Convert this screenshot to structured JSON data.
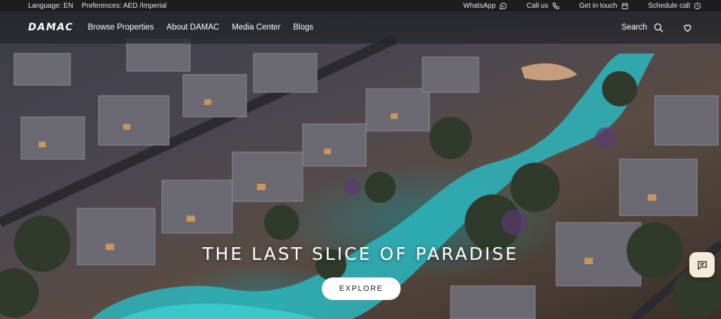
{
  "topbar": {
    "language": "Language: EN",
    "preferences": "Preferences: AED /Imperial",
    "links": [
      {
        "label": "WhatsApp",
        "icon": "whatsapp-icon"
      },
      {
        "label": "Call us",
        "icon": "phone-icon"
      },
      {
        "label": "Get in touch",
        "icon": "calendar-icon"
      },
      {
        "label": "Schedule call",
        "icon": "clock-phone-icon"
      }
    ]
  },
  "nav": {
    "logo": "DAMAC",
    "links": [
      "Browse Properties",
      "About DAMAC",
      "Media Center",
      "Blogs"
    ],
    "search_label": "Search",
    "search_icon": "search-icon",
    "wishlist_icon": "heart-icon"
  },
  "hero": {
    "headline": "THE LAST SLICE OF PARADISE",
    "cta": "EXPLORE",
    "chat_icon": "chat-icon"
  },
  "colors": {
    "topbar_bg": "#1d1d1f",
    "water": "#2bb6bd",
    "chat_bg": "#f4ecd8"
  }
}
